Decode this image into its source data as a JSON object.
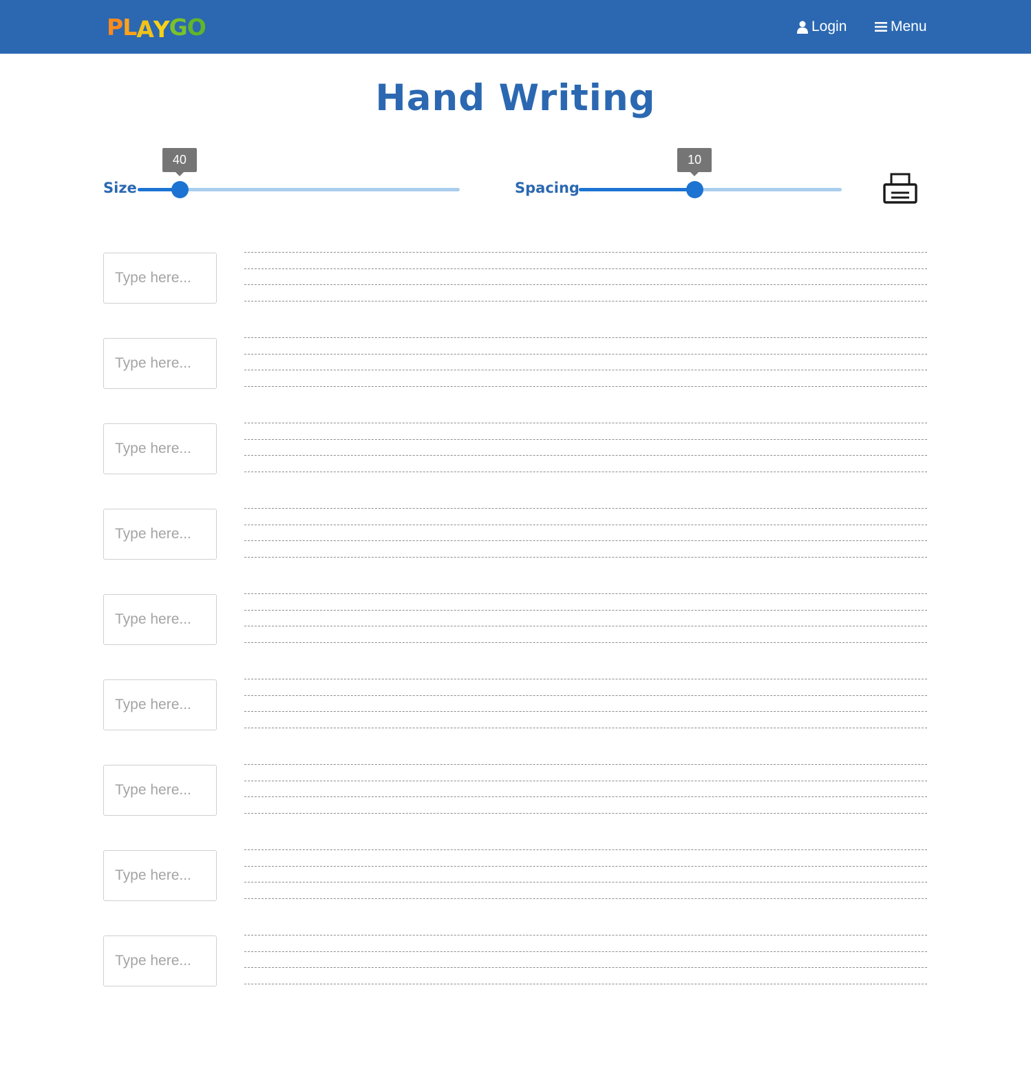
{
  "header": {
    "logo_letters": [
      {
        "char": "P",
        "color": "#ff8a1c"
      },
      {
        "char": "L",
        "color": "#ffa21a"
      },
      {
        "char": "A",
        "color": "#f2c21b"
      },
      {
        "char": "Y",
        "color": "#f7d217"
      },
      {
        "char": "G",
        "color": "#7bc12b"
      },
      {
        "char": "O",
        "color": "#62b52a"
      }
    ],
    "login_label": "Login",
    "menu_label": "Menu"
  },
  "title": "Hand Writing",
  "controls": {
    "size": {
      "label": "Size",
      "value": "40",
      "fraction": 0.13
    },
    "spacing": {
      "label": "Spacing",
      "value": "10",
      "fraction": 0.44
    }
  },
  "rows": [
    {
      "placeholder": "Type here..."
    },
    {
      "placeholder": "Type here..."
    },
    {
      "placeholder": "Type here..."
    },
    {
      "placeholder": "Type here..."
    },
    {
      "placeholder": "Type here..."
    },
    {
      "placeholder": "Type here..."
    },
    {
      "placeholder": "Type here..."
    },
    {
      "placeholder": "Type here..."
    },
    {
      "placeholder": "Type here..."
    }
  ],
  "colors": {
    "header_bg": "#2b68b1",
    "accent": "#1c73d2",
    "track_light": "#a9cdee",
    "tooltip_bg": "#757575"
  }
}
